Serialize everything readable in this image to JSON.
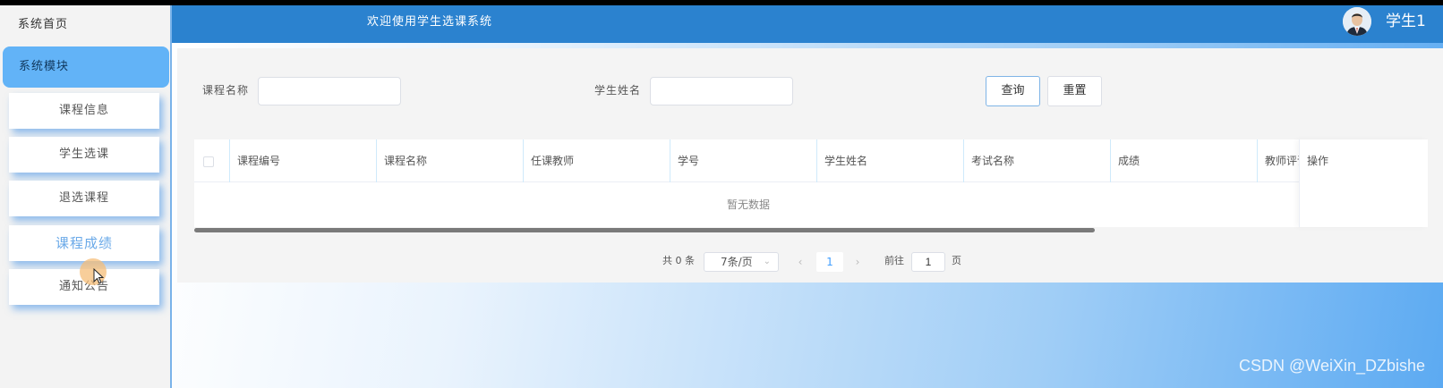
{
  "sidebar": {
    "home_label": "系统首页",
    "module_label": "系统模块",
    "items": [
      {
        "label": "课程信息"
      },
      {
        "label": "学生选课"
      },
      {
        "label": "退选课程"
      },
      {
        "label": "课程成绩",
        "active": true
      },
      {
        "label": "通知公告"
      }
    ]
  },
  "header": {
    "welcome": "欢迎使用学生选课系统",
    "username": "学生1",
    "avatar_icon": "user-avatar"
  },
  "search": {
    "course_name_label": "课程名称",
    "course_name_value": "",
    "student_name_label": "学生姓名",
    "student_name_value": "",
    "query_button": "查询",
    "reset_button": "重置"
  },
  "table": {
    "columns": [
      "课程编号",
      "课程名称",
      "任课教师",
      "学号",
      "学生姓名",
      "考试名称",
      "成绩",
      "教师评语",
      "操作"
    ],
    "empty_text": "暂无数据"
  },
  "pagination": {
    "total_text": "共 0 条",
    "page_size": "7条/页",
    "current_page": "1",
    "goto_label": "前往",
    "goto_value": "1",
    "page_unit": "页"
  },
  "watermark": "CSDN @WeiXin_DZbishe",
  "colors": {
    "header": "#2b82cf",
    "sidebar_active": "#62b3f7",
    "accent": "#409eff"
  }
}
